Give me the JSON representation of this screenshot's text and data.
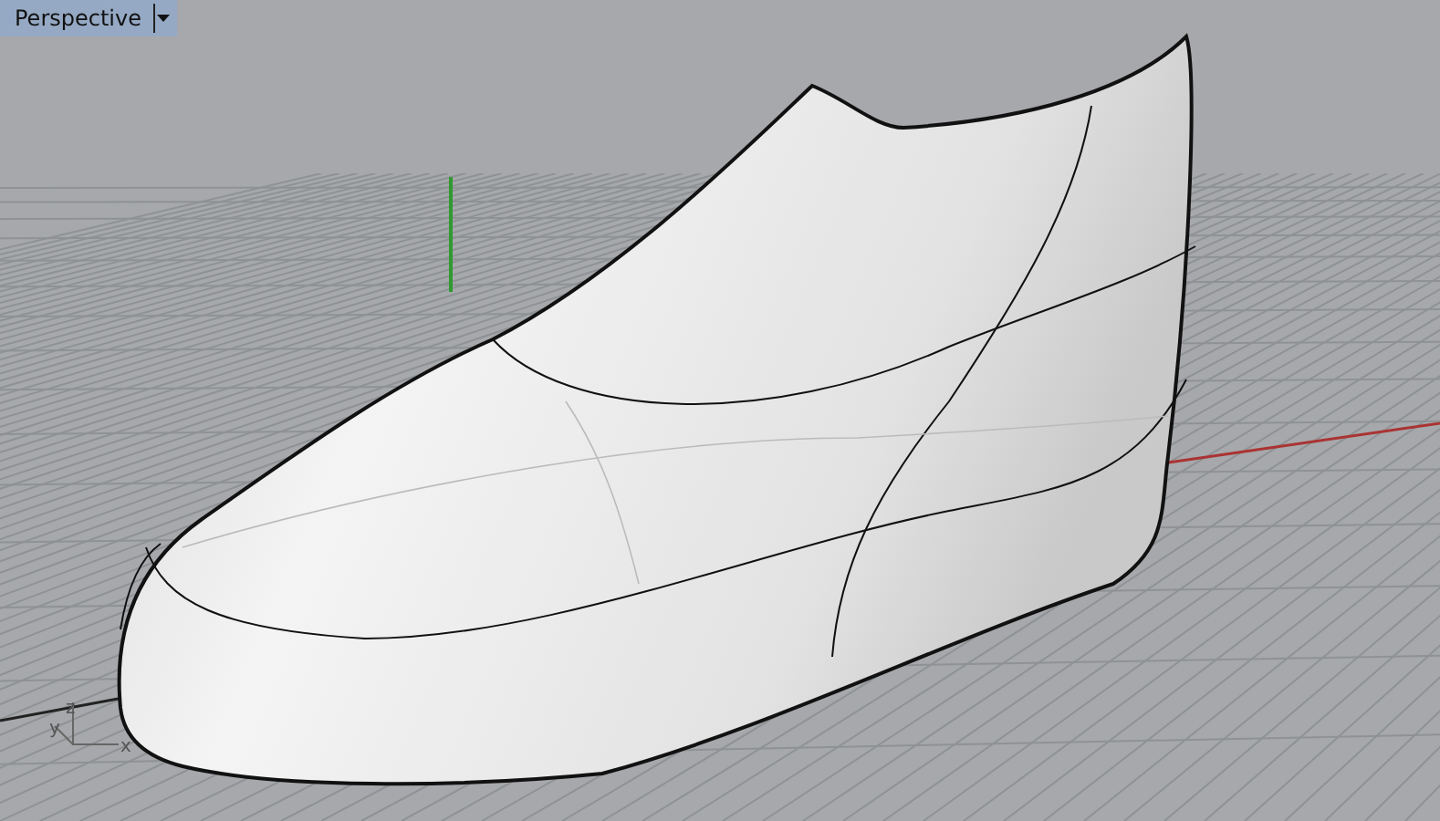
{
  "viewport": {
    "title": "Perspective",
    "axis_labels": [
      "z",
      "y",
      "x"
    ]
  }
}
